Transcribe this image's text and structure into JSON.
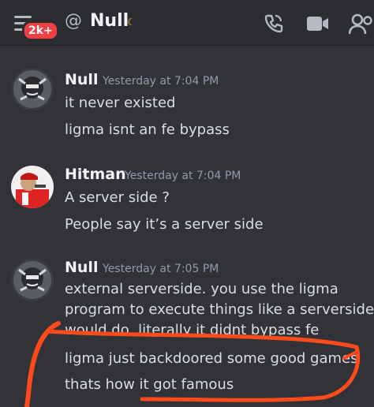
{
  "header": {
    "unread_badge": "2k+",
    "at_symbol": "@",
    "channel_name": "Null",
    "moon_glyph": "☾",
    "icons": [
      "hamburger-menu-icon",
      "call-icon",
      "video-icon",
      "members-icon"
    ]
  },
  "messages": [
    {
      "author": "Null",
      "timestamp": "Yesterday at 7:04 PM",
      "lines": [
        "it never existed",
        "ligma isnt an fe bypass"
      ]
    },
    {
      "author": "Hitman",
      "timestamp": "Yesterday at 7:04 PM",
      "lines": [
        "A server side ?",
        "People say it’s a server side"
      ]
    },
    {
      "author": "Null",
      "timestamp": "Yesterday at 7:05 PM",
      "lines": [
        "external serverside. you use the ligma",
        "program to execute things like a serverside",
        "would do, literally it didnt bypass fe",
        "ligma  just backdoored some good games",
        "thats how it got famous"
      ]
    }
  ],
  "colors": {
    "background": "#313338",
    "header": "#2b2d31",
    "badge": "#f23f43",
    "annotation": "#ff4a1c"
  }
}
